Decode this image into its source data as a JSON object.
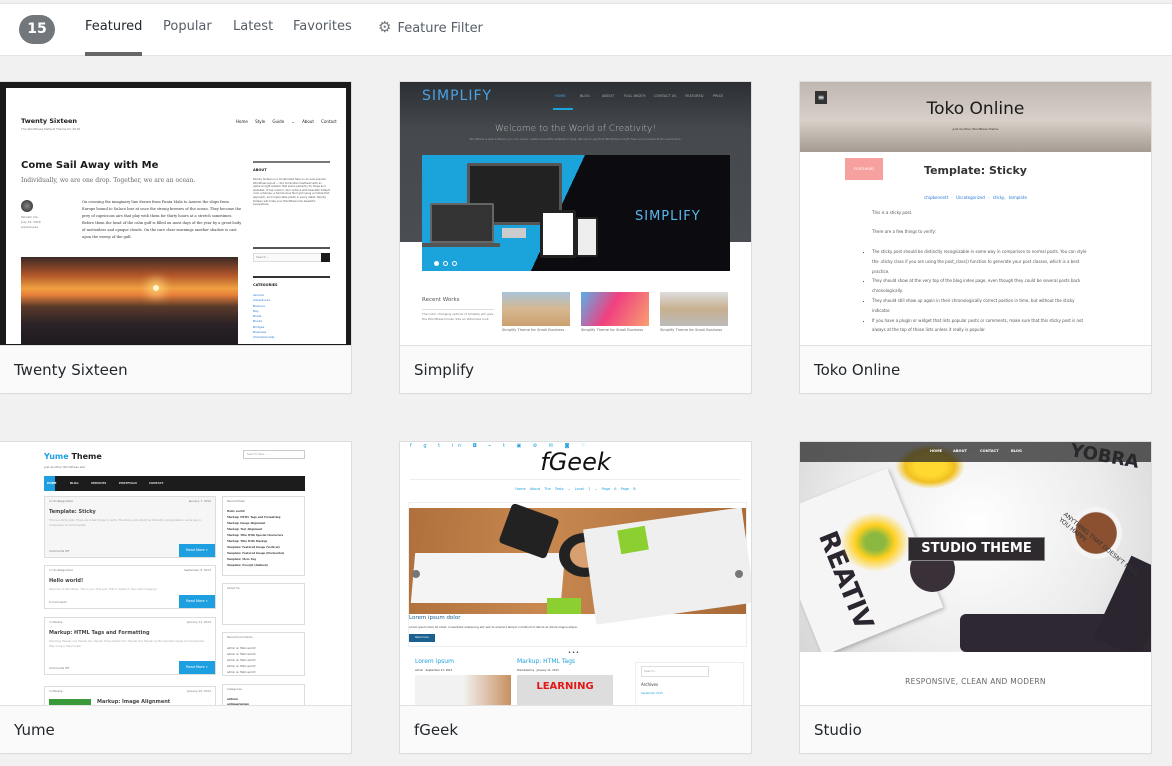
{
  "filter_bar": {
    "count": "15",
    "tabs": [
      {
        "label": "Featured",
        "active": true
      },
      {
        "label": "Popular",
        "active": false
      },
      {
        "label": "Latest",
        "active": false
      },
      {
        "label": "Favorites",
        "active": false
      }
    ],
    "feature_filter": {
      "icon": "gear-icon",
      "label": "Feature Filter"
    }
  },
  "themes": [
    {
      "name": "Twenty Sixteen",
      "preview": {
        "site_title": "Twenty Sixteen",
        "tagline": "The WordPress Default Theme for 2016",
        "nav": [
          "Home",
          "Style Guide ⌄",
          "About",
          "Contact"
        ],
        "post_title": "Come Sail Away with Me",
        "post_subtitle": "Individually, we are one drop. Together, we are an ocean.",
        "post_meta": [
          "Takashi Irie",
          "July 19, 2016",
          "Adventures"
        ],
        "post_body": "On crossing the imaginary line drawn from Punta Mala to Azuero the ships from Europe bound to Sulaco lose at once the strong breezes of the ocean. They become the prey of capricious airs that play with them for thirty hours at a stretch sometimes. Before them the head of the calm gulf is filled on most days of the year by a great body of motionless and opaque clouds. On the rare clear mornings another shadow is cast upon the sweep of the gulf.",
        "about_heading": "ABOUT",
        "about_text": "Twenty Sixteen is a modernized take on an ever-popular WordPress layout — the horizontal masthead with an optional right sidebar that works perfectly for blogs and websites. It has custom color options with beautiful default color schemes, a harmonious fluid grid using a mobile-first approach, and impeccable polish in every detail. Twenty Sixteen will make your WordPress look beautiful everywhere.",
        "search_placeholder": "Search ...",
        "categories_heading": "CATEGORIES",
        "categories": [
          "Abroad",
          "Adventures",
          "Balance",
          "Bay",
          "Boats",
          "Books",
          "Bridges",
          "Business",
          "Championship"
        ]
      }
    },
    {
      "name": "Simplify",
      "preview": {
        "logo": "SIMPLIFY",
        "nav": [
          "HOME",
          "BLOG",
          "ABOUT",
          "FULL WIDTH",
          "CONTACT US",
          "FEATURED",
          "PRICE"
        ],
        "headline": "Welcome to the World of Creativity!",
        "subline": "WordPress is web software you can use to create a beautiful website or blog. We like to say that WordPress is both free and priceless at the same time.",
        "banner_logo": "SIMPLIFY",
        "recent_heading": "Recent Works",
        "recent_text": "The Color changing options of Simplify will give the WordPress Driven Site an attractive look.",
        "works": [
          "Simplify Theme for Small Business",
          "Simplify Theme for Small Business",
          "Simplify Theme for Small Business"
        ]
      }
    },
    {
      "name": "Toko Online",
      "preview": {
        "site_title": "Toko Online",
        "tagline": "Just Another WordPress theme",
        "badge": "FEATURED",
        "post_title": "Template: Sticky",
        "meta": [
          "chipbennett",
          "Uncategorized",
          "sticky, template"
        ],
        "para1": "This is a sticky post.",
        "para2": "There are a few things to verify:",
        "bullets": [
          "The sticky post should be distinctly recognizable in some way in comparison to normal posts. You can style the .sticky class if you are using the post_class() function to generate your post classes, which is a best practice.",
          "They should show at the very top of the blog index page, even though they could be several posts back chronologically.",
          "They should still show up again in their chronologically correct postion in time, but without the sticky indicator.",
          "If you have a plugin or widget that lists popular posts or comments, make sure that this sticky post is not always at the top of those lists unless it really is popular."
        ]
      }
    },
    {
      "name": "Yume",
      "preview": {
        "title_a": "Yume",
        "title_b": " Theme",
        "tagline": "Just another WordPress site",
        "search_placeholder": "Search Here...",
        "nav": [
          "HOME",
          "BLOG",
          "SERVICES",
          "PORTFOLIO",
          "CONTACT"
        ],
        "posts": [
          {
            "cat": "in Uncategorized",
            "date": "January 7, 2012",
            "title": "Template: Sticky",
            "excerpt": "This is a sticky post. There are a few things to verify. The sticky post should be distinctly recognizable in some way in comparison to normal posts.",
            "comments": "Comments Off",
            "more": "Read More »"
          },
          {
            "cat": "in Uncategorized",
            "date": "September 9, 2013",
            "title": "Hello world!",
            "excerpt": "Welcome to WordPress. This is your first post. Edit or delete it, then start blogging!",
            "comments": "6 Comments",
            "more": "Read More »"
          },
          {
            "cat": "in Markup",
            "date": "January 11, 2013",
            "title": "Markup: HTML Tags and Formatting",
            "excerpt": "Headings Header one Header two Header three Header four Header five Header six Blockquotes Single line blockquote: Stay hungry. Stay foolish.",
            "comments": "Comments Off",
            "more": "Read More »"
          },
          {
            "cat": "in Markup",
            "date": "January 10, 2013",
            "title": "Markup: Image Alignment"
          }
        ],
        "widgets": {
          "recent_posts": "Recent Posts",
          "recent_list": [
            "Hello world!",
            "Markup: HTML Tags and Formatting",
            "Markup: Image Alignment",
            "Markup: Text Alignment",
            "Markup: Title With Special Characters",
            "Markup: Title With Markup",
            "Template: Featured Image (Vertical)",
            "Template: Featured Image (Horizontal)",
            "Template: More Tag",
            "Template: Excerpt (Defined)"
          ],
          "about": "About Us",
          "recent_comments": "Recent Comments",
          "comment_item": "admin on Hello world!",
          "categories": "Categories",
          "cat_list": [
            "aciform",
            "antiquarianism"
          ]
        }
      }
    },
    {
      "name": "fGeek",
      "preview": {
        "site_title": "fGeek",
        "nav": [
          "Home",
          "About The Tests ⌄",
          "Level 1 ⌄",
          "Page A",
          "Page B"
        ],
        "slide_title": "Lorem ipsum dolor",
        "slide_text": "Lorem ipsum dolor sit amet, consectetur adipisicing elit, sed do eiusmod tempor incididunt ut labore et dolore magna aliqua.",
        "slide_button": "Read more",
        "post1": {
          "title": "Lorem ipsum",
          "author": "admin",
          "date": "September 27, 2015"
        },
        "post2": {
          "title": "Markup: HTML Tags",
          "author": "themedemos",
          "date": "January 11, 2013",
          "image_text": "LEARNING"
        },
        "search_placeholder": "Search...",
        "archives": "Archives",
        "archive_item": "September 2015"
      }
    },
    {
      "name": "Studio",
      "preview": {
        "nav": [
          "HOME",
          "ABOUT",
          "CONTACT",
          "BLOG"
        ],
        "hero_title": "STUDIO THEME",
        "tagline": "RESPONSIVE, CLEAN AND MODERN"
      }
    }
  ]
}
